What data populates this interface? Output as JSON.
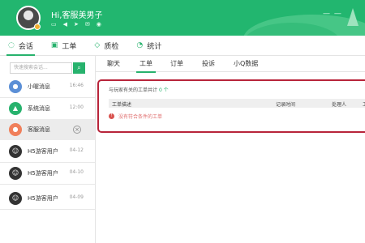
{
  "header": {
    "greeting": "Hi,客服美男子",
    "icons": [
      "chat-icon",
      "volume-icon",
      "send-icon",
      "mail-icon",
      "eye-icon"
    ],
    "dash": "— —",
    "accent": "#22b66f"
  },
  "topnav": [
    {
      "label": "会话",
      "icon": "chat-bubble-icon",
      "active": true
    },
    {
      "label": "工单",
      "icon": "ticket-icon"
    },
    {
      "label": "质检",
      "icon": "shield-icon"
    },
    {
      "label": "统计",
      "icon": "chart-icon"
    }
  ],
  "sidebar": {
    "search_placeholder": "快速搜索会话...",
    "items": [
      {
        "name": "小喔消息",
        "time": "16:46",
        "color": "#5b8fd6",
        "glyph": "●"
      },
      {
        "name": "系统消息",
        "time": "12:00",
        "color": "#27b26d",
        "glyph": "▲"
      },
      {
        "name": "客服消息",
        "time": "",
        "color": "#f07f5a",
        "glyph": "●",
        "active": true
      },
      {
        "name": "H5游客用户",
        "time": "04-12",
        "color": "#333333",
        "glyph": "☺"
      },
      {
        "name": "H5游客用户",
        "time": "04-10",
        "color": "#333333",
        "glyph": "☺"
      },
      {
        "name": "H5游客用户",
        "time": "04-09",
        "color": "#333333",
        "glyph": "☺"
      }
    ]
  },
  "tabs": [
    "聊天",
    "工单",
    "订单",
    "投诉",
    "小Q数据"
  ],
  "active_tab": "工单",
  "panel": {
    "prefix": "与玩家有关的工单共计",
    "count": "0 个",
    "columns": [
      "工单描述",
      "记录时间",
      "处理人",
      "工"
    ],
    "empty_text": "没有符合条件的工单"
  }
}
